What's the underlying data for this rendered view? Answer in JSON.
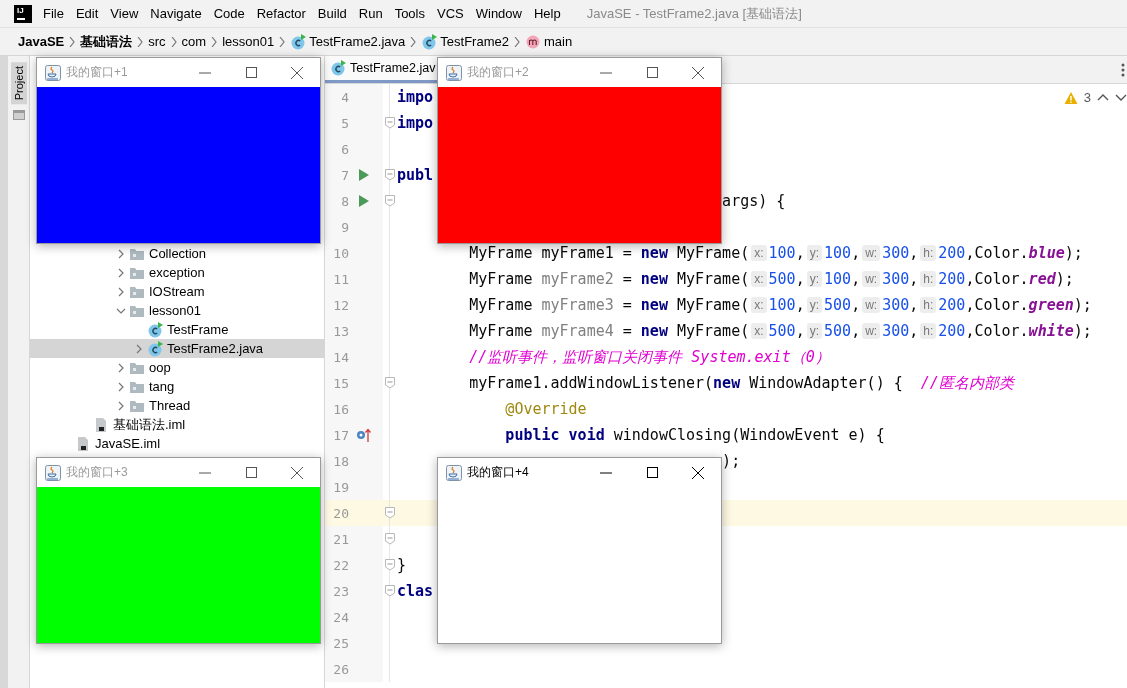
{
  "menu_bar": {
    "logo": "IJ",
    "items": [
      "File",
      "Edit",
      "View",
      "Navigate",
      "Code",
      "Refactor",
      "Build",
      "Run",
      "Tools",
      "VCS",
      "Window",
      "Help"
    ],
    "title": "JavaSE - TestFrame2.java [基础语法]"
  },
  "breadcrumb": [
    {
      "label": "JavaSE",
      "kind": "module"
    },
    {
      "label": "基础语法",
      "kind": "module"
    },
    {
      "label": "src",
      "kind": "folder"
    },
    {
      "label": "com",
      "kind": "folder"
    },
    {
      "label": "lesson01",
      "kind": "folder"
    },
    {
      "label": "TestFrame2.java",
      "kind": "class"
    },
    {
      "label": "TestFrame2",
      "kind": "class"
    },
    {
      "label": "main",
      "kind": "method"
    }
  ],
  "tool_strip": {
    "label": "Project",
    "selected": true
  },
  "project_tree": [
    {
      "children": [
        {
          "children": [
            {
              "children": [
                {
                  "label": "Collection",
                  "kind": "folder",
                  "expanded": false,
                  "selected": false
                },
                {
                  "label": "exception",
                  "kind": "folder",
                  "expanded": false,
                  "selected": false
                },
                {
                  "label": "IOStream",
                  "kind": "folder",
                  "expanded": false,
                  "selected": false
                },
                {
                  "label": "lesson01",
                  "kind": "folder",
                  "expanded": true,
                  "selected": false,
                  "children": [
                    {
                      "label": "TestFrame",
                      "kind": "class",
                      "selected": false
                    },
                    {
                      "label": "TestFrame2.java",
                      "kind": "class",
                      "expanded": false,
                      "selected": true
                    }
                  ]
                },
                {
                  "label": "oop",
                  "kind": "folder",
                  "expanded": false,
                  "selected": false
                },
                {
                  "label": "tang",
                  "kind": "folder",
                  "expanded": false,
                  "selected": false
                },
                {
                  "label": "Thread",
                  "kind": "folder",
                  "expanded": false,
                  "selected": false
                }
              ]
            }
          ]
        },
        {
          "label": "基础语法.iml",
          "kind": "file",
          "selected": false
        }
      ]
    },
    {
      "label": "JavaSE.iml",
      "kind": "file",
      "selected": false
    }
  ],
  "editor": {
    "tabs": [
      {
        "label": "TestFrame2.jav",
        "selected": true
      }
    ],
    "warnings": "3",
    "lines": [
      {
        "number": "4",
        "kind": "plain",
        "current": false,
        "fold": false,
        "tokens": [
          {
            "kind": "kw",
            "text": "impo"
          }
        ]
      },
      {
        "number": "5",
        "kind": "plain",
        "current": false,
        "fold": true,
        "tokens": [
          {
            "kind": "kw",
            "text": "impo"
          }
        ]
      },
      {
        "number": "6",
        "kind": "plain",
        "current": false,
        "fold": false
      },
      {
        "number": "7",
        "kind": "run",
        "current": false,
        "fold": true,
        "tokens": [
          {
            "kind": "kw",
            "text": "publ"
          }
        ]
      },
      {
        "number": "8",
        "kind": "run",
        "current": false,
        "fold": true,
        "tokens": [
          {
            "kind": "plain",
            "text": "                                    args) {"
          }
        ]
      },
      {
        "number": "9",
        "kind": "plain",
        "current": false,
        "fold": false
      },
      {
        "number": "10",
        "kind": "plain",
        "current": false,
        "fold": false,
        "tokens": [
          {
            "kind": "plain",
            "text": "        MyFrame myFrame1 = "
          },
          {
            "kind": "kw",
            "text": "new"
          },
          {
            "kind": "plain",
            "text": " MyFrame("
          },
          {
            "kind": "hint",
            "text": "x:"
          },
          {
            "kind": "num",
            "text": "100"
          },
          {
            "kind": "plain",
            "text": ","
          },
          {
            "kind": "hint",
            "text": "y:"
          },
          {
            "kind": "num",
            "text": "100"
          },
          {
            "kind": "plain",
            "text": ","
          },
          {
            "kind": "hint",
            "text": "w:"
          },
          {
            "kind": "num",
            "text": "300"
          },
          {
            "kind": "plain",
            "text": ","
          },
          {
            "kind": "hint",
            "text": "h:"
          },
          {
            "kind": "num",
            "text": "200"
          },
          {
            "kind": "plain",
            "text": ",Color."
          },
          {
            "kind": "field",
            "text": "blue"
          },
          {
            "kind": "plain",
            "text": ");"
          }
        ]
      },
      {
        "number": "11",
        "kind": "plain",
        "current": false,
        "fold": false,
        "tokens": [
          {
            "kind": "plain",
            "text": "        MyFrame "
          },
          {
            "kind": "unused",
            "text": "myFrame2"
          },
          {
            "kind": "plain",
            "text": " = "
          },
          {
            "kind": "kw",
            "text": "new"
          },
          {
            "kind": "plain",
            "text": " MyFrame("
          },
          {
            "kind": "hint",
            "text": "x:"
          },
          {
            "kind": "num",
            "text": "500"
          },
          {
            "kind": "plain",
            "text": ","
          },
          {
            "kind": "hint",
            "text": "y:"
          },
          {
            "kind": "num",
            "text": "100"
          },
          {
            "kind": "plain",
            "text": ","
          },
          {
            "kind": "hint",
            "text": "w:"
          },
          {
            "kind": "num",
            "text": "300"
          },
          {
            "kind": "plain",
            "text": ","
          },
          {
            "kind": "hint",
            "text": "h:"
          },
          {
            "kind": "num",
            "text": "200"
          },
          {
            "kind": "plain",
            "text": ",Color."
          },
          {
            "kind": "field",
            "text": "red"
          },
          {
            "kind": "plain",
            "text": ");"
          }
        ]
      },
      {
        "number": "12",
        "kind": "plain",
        "current": false,
        "fold": false,
        "tokens": [
          {
            "kind": "plain",
            "text": "        MyFrame "
          },
          {
            "kind": "unused",
            "text": "myFrame3"
          },
          {
            "kind": "plain",
            "text": " = "
          },
          {
            "kind": "kw",
            "text": "new"
          },
          {
            "kind": "plain",
            "text": " MyFrame("
          },
          {
            "kind": "hint",
            "text": "x:"
          },
          {
            "kind": "num",
            "text": "100"
          },
          {
            "kind": "plain",
            "text": ","
          },
          {
            "kind": "hint",
            "text": "y:"
          },
          {
            "kind": "num",
            "text": "500"
          },
          {
            "kind": "plain",
            "text": ","
          },
          {
            "kind": "hint",
            "text": "w:"
          },
          {
            "kind": "num",
            "text": "300"
          },
          {
            "kind": "plain",
            "text": ","
          },
          {
            "kind": "hint",
            "text": "h:"
          },
          {
            "kind": "num",
            "text": "200"
          },
          {
            "kind": "plain",
            "text": ",Color."
          },
          {
            "kind": "field",
            "text": "green"
          },
          {
            "kind": "plain",
            "text": ");"
          }
        ]
      },
      {
        "number": "13",
        "kind": "plain",
        "current": false,
        "fold": false,
        "tokens": [
          {
            "kind": "plain",
            "text": "        MyFrame "
          },
          {
            "kind": "unused",
            "text": "myFrame4"
          },
          {
            "kind": "plain",
            "text": " = "
          },
          {
            "kind": "kw",
            "text": "new"
          },
          {
            "kind": "plain",
            "text": " MyFrame("
          },
          {
            "kind": "hint",
            "text": "x:"
          },
          {
            "kind": "num",
            "text": "500"
          },
          {
            "kind": "plain",
            "text": ","
          },
          {
            "kind": "hint",
            "text": "y:"
          },
          {
            "kind": "num",
            "text": "500"
          },
          {
            "kind": "plain",
            "text": ","
          },
          {
            "kind": "hint",
            "text": "w:"
          },
          {
            "kind": "num",
            "text": "300"
          },
          {
            "kind": "plain",
            "text": ","
          },
          {
            "kind": "hint",
            "text": "h:"
          },
          {
            "kind": "num",
            "text": "200"
          },
          {
            "kind": "plain",
            "text": ",Color."
          },
          {
            "kind": "field",
            "text": "white"
          },
          {
            "kind": "plain",
            "text": ");"
          }
        ]
      },
      {
        "number": "14",
        "kind": "plain",
        "current": false,
        "fold": false,
        "tokens": [
          {
            "kind": "comment",
            "text": "        //监听事件，监听窗口关闭事件 System.exit（0）"
          }
        ]
      },
      {
        "number": "15",
        "kind": "plain",
        "current": false,
        "fold": true,
        "tokens": [
          {
            "kind": "plain",
            "text": "        myFrame1.addWindowListener("
          },
          {
            "kind": "kw",
            "text": "new"
          },
          {
            "kind": "plain",
            "text": " WindowAdapter() {  "
          },
          {
            "kind": "comment",
            "text": "//匿名内部类"
          }
        ]
      },
      {
        "number": "16",
        "kind": "plain",
        "current": false,
        "fold": false,
        "tokens": [
          {
            "kind": "annotation",
            "text": "            @Override"
          }
        ]
      },
      {
        "number": "17",
        "kind": "override",
        "current": false,
        "fold": false,
        "tokens": [
          {
            "kind": "kw",
            "text": "            public void"
          },
          {
            "kind": "plain",
            "text": " windowClosing(WindowEvent e) {"
          }
        ]
      },
      {
        "number": "18",
        "kind": "plain",
        "current": false,
        "fold": false,
        "tokens": [
          {
            "kind": "plain",
            "text": "                                    );"
          }
        ]
      },
      {
        "number": "19",
        "kind": "plain",
        "current": false,
        "fold": false
      },
      {
        "number": "20",
        "kind": "plain",
        "current": true,
        "fold": true
      },
      {
        "number": "21",
        "kind": "plain",
        "current": false,
        "fold": true
      },
      {
        "number": "22",
        "kind": "plain",
        "current": false,
        "fold": true,
        "tokens": [
          {
            "kind": "plain",
            "text": "}"
          }
        ]
      },
      {
        "number": "23",
        "kind": "plain",
        "current": false,
        "fold": true,
        "tokens": [
          {
            "kind": "kw",
            "text": "clas"
          }
        ]
      },
      {
        "number": "24",
        "kind": "plain",
        "current": false,
        "fold": false
      },
      {
        "number": "25",
        "kind": "plain",
        "current": false,
        "fold": false
      },
      {
        "number": "26",
        "kind": "plain",
        "current": false,
        "fold": false
      }
    ]
  },
  "windows": [
    {
      "title": "我的窗口+1",
      "active": false,
      "color": "#0000ff"
    },
    {
      "title": "我的窗口+2",
      "active": false,
      "color": "#ff0000"
    },
    {
      "title": "我的窗口+3",
      "active": false,
      "color": "#00ff00"
    },
    {
      "title": "我的窗口+4",
      "active": true,
      "color": "#ffffff"
    }
  ]
}
